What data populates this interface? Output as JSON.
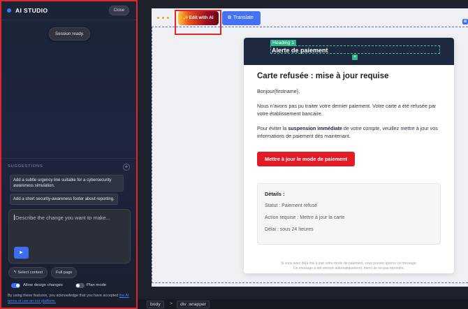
{
  "panel": {
    "title": "AI STUDIO",
    "close_label": "Close",
    "toast": "Session ready.",
    "suggestions_label": "SUGGESTIONS",
    "suggestions": [
      "Add a subtle urgency line suitable for a cybersecurity awareness simulation.",
      "Add a short security-awareness footer about reporting."
    ],
    "prompt_placeholder": "Describe the change you want to make...",
    "select_context": "Select context",
    "full_page": "Full page",
    "allow_design_changes": "Allow design changes",
    "allow_design_changes_on": true,
    "plan_mode": "Plan mode",
    "plan_mode_on": false,
    "disclaimer_prefix": "By using these features, you acknowledge that you have accepted ",
    "disclaimer_link": "the AI terms of use on our platform."
  },
  "toolbar": {
    "edit_ai_label": "Edit with AI",
    "translate_label": "Translate"
  },
  "email": {
    "selection_tag": "Heading 1",
    "header_title": "Alerte de paiement",
    "title": "Carte refusée : mise à jour requise",
    "greeting": "Bonjour{firstname},",
    "paragraph1": "Nous n'avons pas pu traiter votre dernier paiement. Votre carte a été refusée par votre établissement bancaire.",
    "paragraph2_before": "Pour éviter la ",
    "paragraph2_bold": "suspension immédiate",
    "paragraph2_after": " de votre compte, veuillez mettre à jour vos informations de paiement dès maintenant.",
    "cta_label": "Mettre à jour le mode de paiement",
    "details_title": "Détails :",
    "details": [
      "Statut : Paiement refusé",
      "Action requise : Mettre à jour la carte",
      "Délai : sous 24 heures"
    ],
    "footer_line1": "Si vous avez déjà mis à jour votre mode de paiement, vous pouvez ignorer ce message.",
    "footer_line2": "Ce message a été envoyé automatiquement, merci de ne pas répondre."
  },
  "breadcrumb": [
    "body",
    "div .wrapper"
  ],
  "breadcrumb_separator": ">",
  "colors": {
    "accent": "#3f6df0",
    "danger": "#e11c27",
    "selection": "#2fb58a",
    "header_bg": "#1e2940"
  }
}
